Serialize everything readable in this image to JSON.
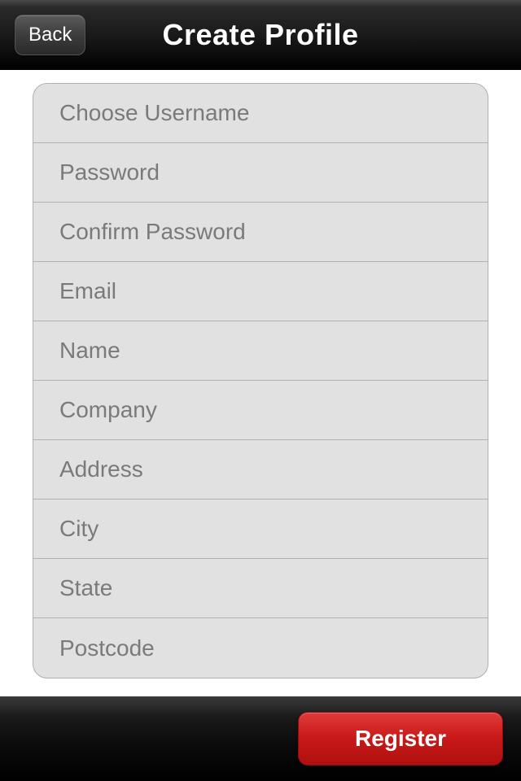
{
  "header": {
    "back_label": "Back",
    "title": "Create Profile"
  },
  "form": {
    "fields": [
      {
        "placeholder": "Choose Username"
      },
      {
        "placeholder": "Password"
      },
      {
        "placeholder": "Confirm Password"
      },
      {
        "placeholder": "Email"
      },
      {
        "placeholder": "Name"
      },
      {
        "placeholder": "Company"
      },
      {
        "placeholder": "Address"
      },
      {
        "placeholder": "City"
      },
      {
        "placeholder": "State"
      },
      {
        "placeholder": "Postcode"
      }
    ]
  },
  "footer": {
    "register_label": "Register"
  }
}
